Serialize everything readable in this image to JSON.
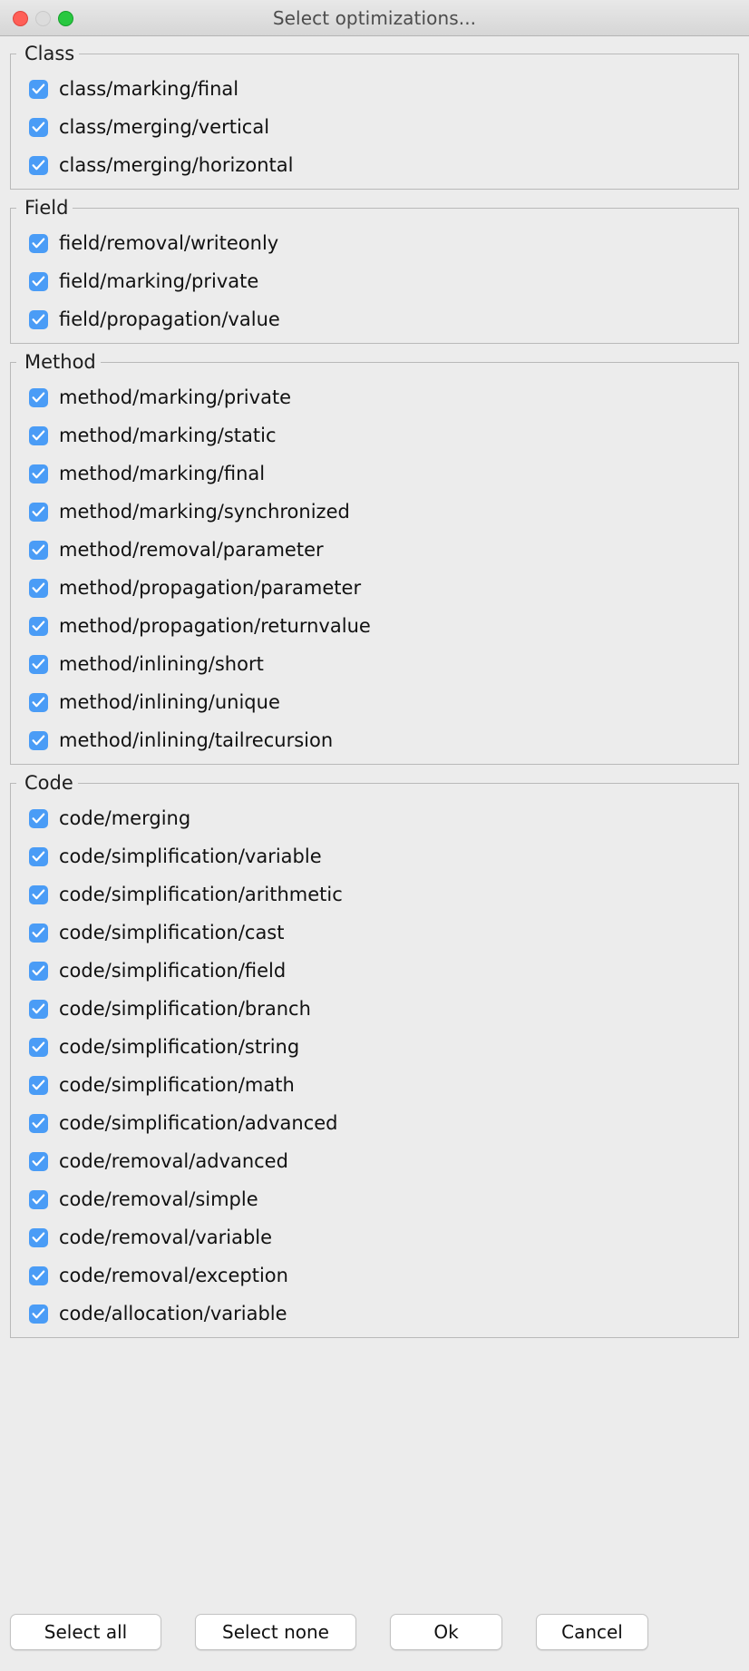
{
  "window": {
    "title": "Select optimizations...",
    "traffic_lights": [
      {
        "name": "close-button",
        "color": "#ff5f57"
      },
      {
        "name": "minimize-button",
        "color": "#dcdcdc"
      },
      {
        "name": "maximize-button",
        "color": "#28c840"
      }
    ]
  },
  "accent_color": "#4a9cf6",
  "groups": [
    {
      "legend": "Class",
      "items": [
        {
          "label": "class/marking/final",
          "checked": true
        },
        {
          "label": "class/merging/vertical",
          "checked": true
        },
        {
          "label": "class/merging/horizontal",
          "checked": true
        }
      ]
    },
    {
      "legend": "Field",
      "items": [
        {
          "label": "field/removal/writeonly",
          "checked": true
        },
        {
          "label": "field/marking/private",
          "checked": true
        },
        {
          "label": "field/propagation/value",
          "checked": true
        }
      ]
    },
    {
      "legend": "Method",
      "items": [
        {
          "label": "method/marking/private",
          "checked": true
        },
        {
          "label": "method/marking/static",
          "checked": true
        },
        {
          "label": "method/marking/final",
          "checked": true
        },
        {
          "label": "method/marking/synchronized",
          "checked": true
        },
        {
          "label": "method/removal/parameter",
          "checked": true
        },
        {
          "label": "method/propagation/parameter",
          "checked": true
        },
        {
          "label": "method/propagation/returnvalue",
          "checked": true
        },
        {
          "label": "method/inlining/short",
          "checked": true
        },
        {
          "label": "method/inlining/unique",
          "checked": true
        },
        {
          "label": "method/inlining/tailrecursion",
          "checked": true
        }
      ]
    },
    {
      "legend": "Code",
      "items": [
        {
          "label": "code/merging",
          "checked": true
        },
        {
          "label": "code/simplification/variable",
          "checked": true
        },
        {
          "label": "code/simplification/arithmetic",
          "checked": true
        },
        {
          "label": "code/simplification/cast",
          "checked": true
        },
        {
          "label": "code/simplification/field",
          "checked": true
        },
        {
          "label": "code/simplification/branch",
          "checked": true
        },
        {
          "label": "code/simplification/string",
          "checked": true
        },
        {
          "label": "code/simplification/math",
          "checked": true
        },
        {
          "label": "code/simplification/advanced",
          "checked": true
        },
        {
          "label": "code/removal/advanced",
          "checked": true
        },
        {
          "label": "code/removal/simple",
          "checked": true
        },
        {
          "label": "code/removal/variable",
          "checked": true
        },
        {
          "label": "code/removal/exception",
          "checked": true
        },
        {
          "label": "code/allocation/variable",
          "checked": true
        }
      ]
    }
  ],
  "buttons": [
    {
      "name": "select-all-button",
      "label": "Select all",
      "width": "w-wide"
    },
    {
      "name": "select-none-button",
      "label": "Select none",
      "width": "w-med"
    },
    {
      "name": "ok-button",
      "label": "Ok",
      "width": "w-narrow"
    },
    {
      "name": "cancel-button",
      "label": "Cancel",
      "width": "w-narrow"
    }
  ]
}
